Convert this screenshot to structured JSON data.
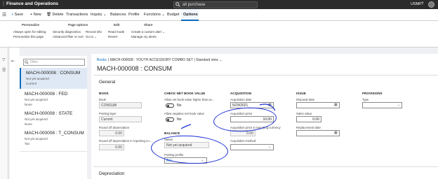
{
  "app": {
    "title": "Finance and Operations",
    "search": "all purchase",
    "company": "USMF",
    "help": "?"
  },
  "actionbar": {
    "save": "Save",
    "new": "+ New",
    "delete": "Delete",
    "transactions": "Transactions",
    "inquiry": "Inquiry ⌄",
    "balances": "Balances",
    "profile": "Profile",
    "functions": "Functions ⌄",
    "budget": "Budget",
    "options": "Options"
  },
  "ribbon": {
    "personalize": {
      "title": "Personalize",
      "items": [
        "Always open for editing",
        "Personalize this page"
      ]
    },
    "page_options": {
      "title": "Page options",
      "items": [
        "Security diagnostics",
        "Advanced filter or sort",
        "Record info",
        "Go to ⌄"
      ]
    },
    "edit": {
      "title": "Edit",
      "items": [
        "Read mode",
        "Revert"
      ]
    },
    "share": {
      "title": "Share",
      "items": [
        "Create a custom alert ⌄",
        "Manage my alerts"
      ]
    }
  },
  "list": {
    "filter_placeholder": "Filter",
    "items": [
      {
        "title": "MACH-000008 : CONSUM",
        "status": "Not yet acquired",
        "extra": "Current"
      },
      {
        "title": "MACH-000008 : FED",
        "status": "Not yet acquired",
        "extra": "None"
      },
      {
        "title": "MACH-000008 : STATE",
        "status": "Not yet acquired",
        "extra": "None"
      },
      {
        "title": "MACH-000008 : T_CONSUM",
        "status": "Not yet acquired",
        "extra": "Tax"
      }
    ]
  },
  "detail": {
    "breadcrumb_books": "Books",
    "breadcrumb_rest": "|  MACH-000008 : YOUTH ACCESSORY COMBO SET  |  Standard view ⌄",
    "page_title": "MACH-000008 : CONSUM",
    "section_general": "General",
    "section_depreciation": "Depreciation",
    "book": {
      "header": "BOOK",
      "book_label": "Book",
      "book_value": "CONSUM",
      "posting_layer_label": "Posting layer",
      "posting_layer_value": "Current",
      "round_off_label": "Round off depreciation",
      "round_off_value": "0.00",
      "round_off_reporting_label": "Round off depreciation in reporting cu...",
      "round_off_reporting_value": "0.00"
    },
    "check_nbv": {
      "header": "CHECK NET BOOK VALUE",
      "allow_higher_label": "Allow net book value higher than ac...",
      "allow_higher_value": "No",
      "allow_negative_label": "Allow negative net book value",
      "allow_negative_value": "No"
    },
    "balance": {
      "header": "BALANCE",
      "status_label": "Status",
      "status_value": "Not yet acquired",
      "posting_profile_label": "Posting profile",
      "posting_profile_value": "ALL"
    },
    "acquisition": {
      "header": "ACQUISITION",
      "date_label": "Acquisition date",
      "date_value": "5/29/2021",
      "price_label": "Acquisition price",
      "price_value": "10.00",
      "price_reporting_label": "Acquisition price in reporting currency",
      "price_reporting_value": "0.00",
      "method_label": "Acquisition method",
      "method_value": ""
    },
    "issue": {
      "header": "ISSUE",
      "disposal_label": "Disposal date",
      "disposal_value": "",
      "sales_label": "Sales value",
      "sales_value": "0.00",
      "replacement_label": "Replacement date",
      "replacement_value": ""
    },
    "provisions": {
      "header": "PROVISIONS",
      "type_label": "Type",
      "type_value": ""
    }
  },
  "colors": {
    "accent": "#0f6cbd",
    "topbar": "#2b2b2b",
    "ink": "#1a2fd6"
  }
}
